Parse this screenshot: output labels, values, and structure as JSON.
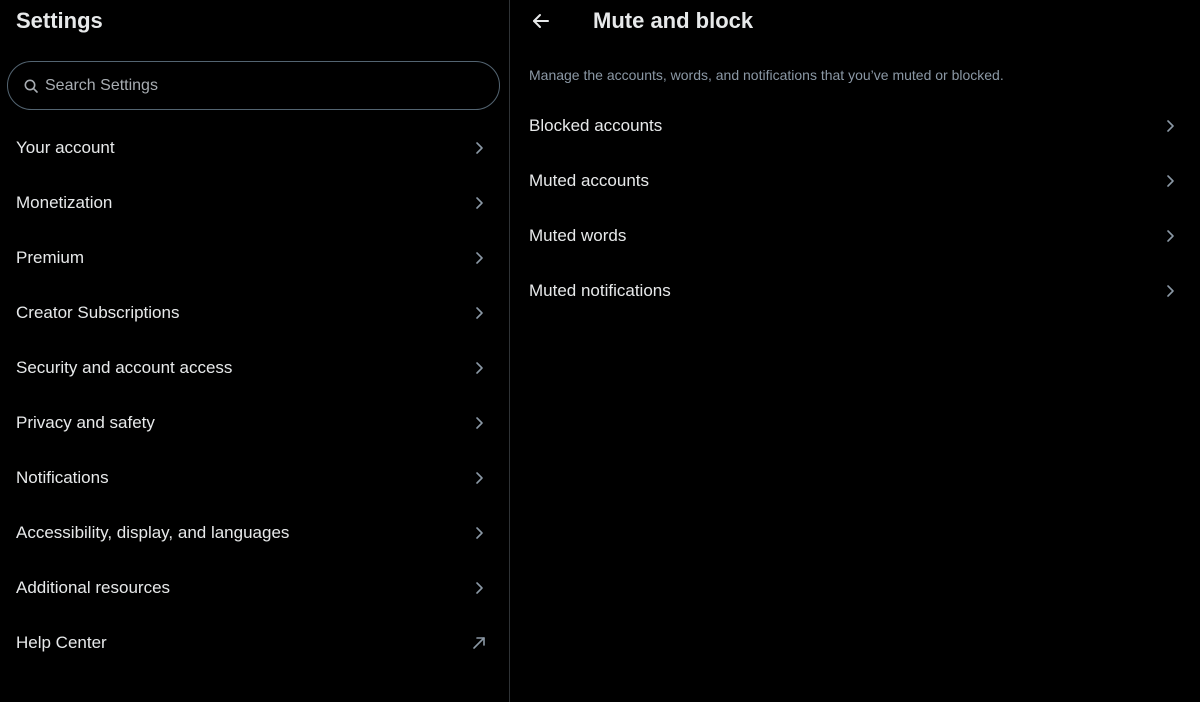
{
  "settings": {
    "title": "Settings",
    "search": {
      "placeholder": "Search Settings",
      "value": ""
    },
    "items": [
      {
        "label": "Your account",
        "icon": "chevron-right-icon"
      },
      {
        "label": "Monetization",
        "icon": "chevron-right-icon"
      },
      {
        "label": "Premium",
        "icon": "chevron-right-icon"
      },
      {
        "label": "Creator Subscriptions",
        "icon": "chevron-right-icon"
      },
      {
        "label": "Security and account access",
        "icon": "chevron-right-icon"
      },
      {
        "label": "Privacy and safety",
        "icon": "chevron-right-icon"
      },
      {
        "label": "Notifications",
        "icon": "chevron-right-icon"
      },
      {
        "label": "Accessibility, display, and languages",
        "icon": "chevron-right-icon"
      },
      {
        "label": "Additional resources",
        "icon": "chevron-right-icon"
      },
      {
        "label": "Help Center",
        "icon": "external-link-arrow-icon"
      }
    ]
  },
  "detail": {
    "title": "Mute and block",
    "back_icon": "back-arrow-icon",
    "description": "Manage the accounts, words, and notifications that you’ve muted or blocked.",
    "options": [
      {
        "label": "Blocked accounts"
      },
      {
        "label": "Muted accounts"
      },
      {
        "label": "Muted words"
      },
      {
        "label": "Muted notifications"
      }
    ]
  },
  "colors": {
    "background": "#000000",
    "text_primary": "#e7e9ea",
    "text_secondary": "#8b98a5",
    "border": "#2f3336",
    "search_border": "#536471"
  }
}
